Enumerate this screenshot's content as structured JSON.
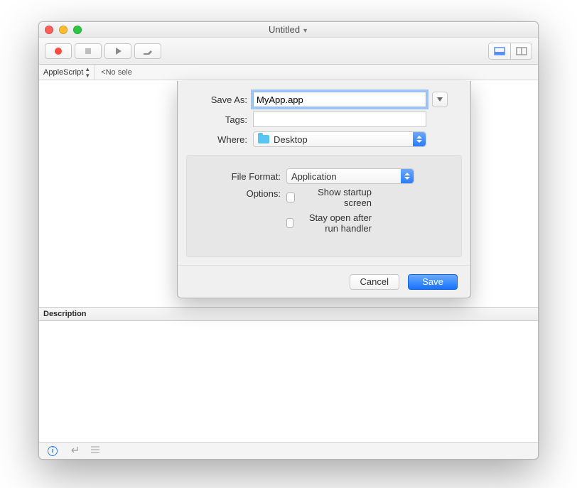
{
  "window": {
    "title": "Untitled"
  },
  "toolbar": {
    "record": "record",
    "stop": "stop",
    "run": "run",
    "build": "build",
    "view_left": "view-left",
    "view_right": "view-right"
  },
  "subbar": {
    "language": "AppleScript",
    "selector": "<No sele"
  },
  "description_label": "Description",
  "sheet": {
    "save_as_label": "Save As:",
    "save_as_value": "MyApp.app",
    "tags_label": "Tags:",
    "tags_value": "",
    "where_label": "Where:",
    "where_value": "Desktop",
    "file_format_label": "File Format:",
    "file_format_value": "Application",
    "options_label": "Options:",
    "option_startup": "Show startup screen",
    "option_stayopen": "Stay open after run handler",
    "cancel": "Cancel",
    "save": "Save"
  }
}
